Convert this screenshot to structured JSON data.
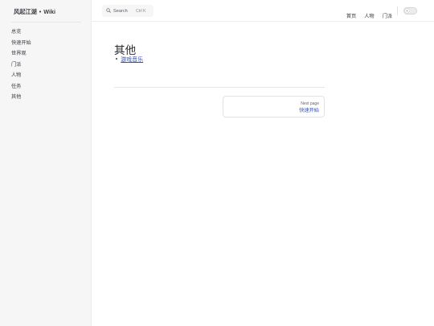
{
  "sidebar": {
    "brand": {
      "name": "风起江湖",
      "separator": "•",
      "suffix": "Wiki"
    },
    "items": [
      {
        "label": "总览"
      },
      {
        "label": "快速开始"
      },
      {
        "label": "世界观"
      },
      {
        "label": "门派"
      },
      {
        "label": "人物"
      },
      {
        "label": "任务"
      },
      {
        "label": "其他"
      }
    ]
  },
  "topbar": {
    "search": {
      "label": "Search",
      "shortcut": "Ctrl K",
      "icon": "search-icon"
    },
    "nav": [
      {
        "label": "首页"
      },
      {
        "label": "人物"
      },
      {
        "label": "门派"
      }
    ],
    "theme_toggle": {
      "icon": "sun-icon"
    }
  },
  "main": {
    "title": "其他",
    "links": [
      {
        "label": "游戏音乐"
      }
    ],
    "pager": {
      "next_desc": "Next page",
      "next_title": "快速开始"
    }
  },
  "colors": {
    "sidebar_bg": "#f6f6f7",
    "link": "#3451b2",
    "text": "#3c3c43"
  }
}
